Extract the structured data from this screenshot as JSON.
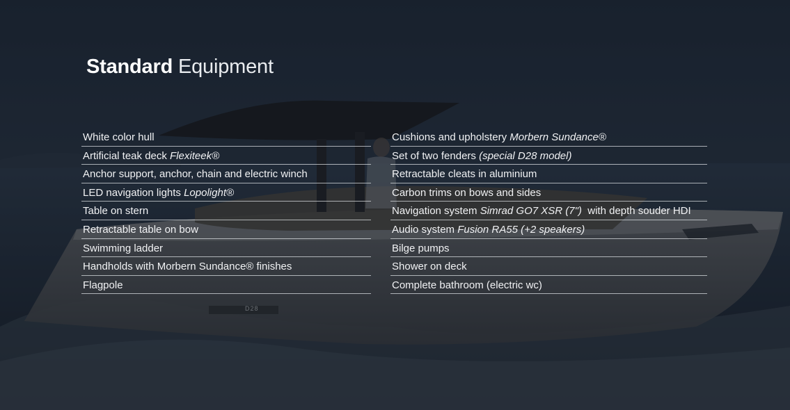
{
  "title": {
    "bold": "Standard",
    "light": "Equipment"
  },
  "left_items": [
    {
      "text": "White color hull",
      "italic": "",
      "suffix": ""
    },
    {
      "text": "Artificial teak deck ",
      "italic": "Flexiteek®",
      "suffix": ""
    },
    {
      "text": "Anchor support, anchor, chain and electric winch",
      "italic": "",
      "suffix": ""
    },
    {
      "text": "LED navigation lights ",
      "italic": "Lopolight®",
      "suffix": ""
    },
    {
      "text": "Table on stern",
      "italic": "",
      "suffix": ""
    },
    {
      "text": "Retractable table on bow",
      "italic": "",
      "suffix": ""
    },
    {
      "text": "Swimming ladder",
      "italic": "",
      "suffix": ""
    },
    {
      "text": "Handholds with Morbern Sundance® finishes",
      "italic": "",
      "suffix": ""
    },
    {
      "text": "Flagpole",
      "italic": "",
      "suffix": ""
    }
  ],
  "right_items": [
    {
      "text": "Cushions and upholstery ",
      "italic": "Morbern Sundance®",
      "suffix": ""
    },
    {
      "text": "Set of two fenders ",
      "italic": "(special D28 model)",
      "suffix": ""
    },
    {
      "text": "Retractable cleats in aluminium",
      "italic": "",
      "suffix": ""
    },
    {
      "text": "Carbon trims on bows and sides",
      "italic": "",
      "suffix": ""
    },
    {
      "text": "Navigation system ",
      "italic": "Simrad GO7 XSR (7\")",
      "suffix": "  with depth souder HDI"
    },
    {
      "text": "Audio system ",
      "italic": "Fusion RA55 (+2 speakers)",
      "suffix": ""
    },
    {
      "text": "Bilge pumps",
      "italic": "",
      "suffix": ""
    },
    {
      "text": "Shower on deck",
      "italic": "",
      "suffix": ""
    },
    {
      "text": "Complete bathroom (electric wc)",
      "italic": "",
      "suffix": ""
    }
  ],
  "hull_badge": "D28",
  "colors": {
    "background": "#1c2530",
    "text": "#ffffff",
    "divider": "#e1e4e8"
  }
}
